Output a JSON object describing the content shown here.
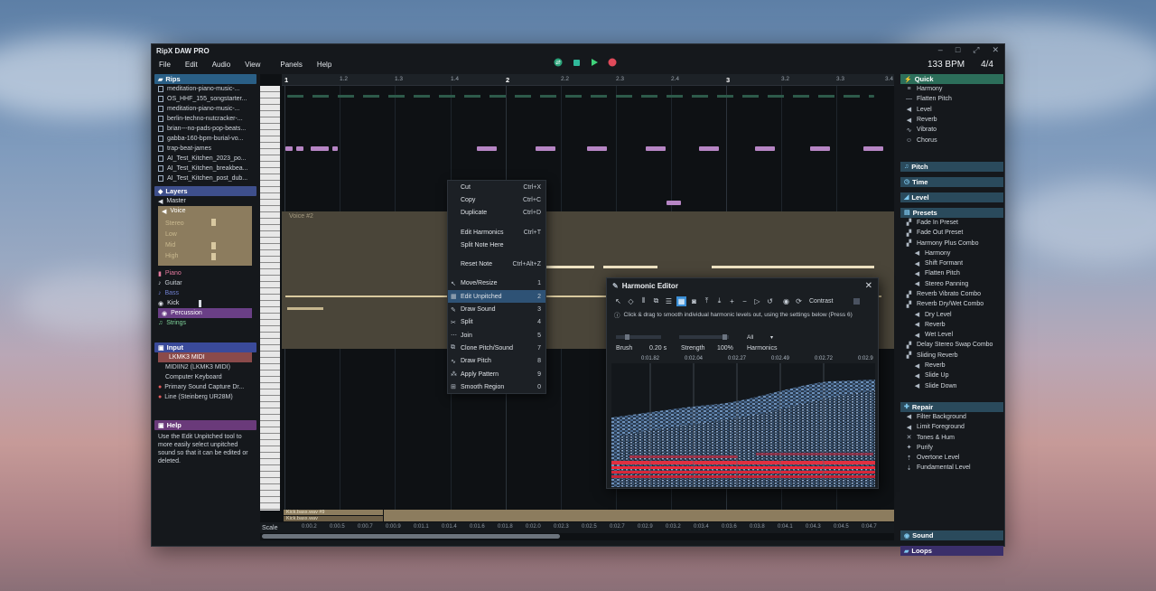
{
  "app": {
    "title": "RipX DAW PRO",
    "menu": [
      "File",
      "Edit",
      "Audio",
      "View",
      "Panels",
      "Help"
    ],
    "bpm": "133 BPM",
    "time_signature": "4/4"
  },
  "left": {
    "rips_header": "Rips",
    "rips": [
      "meditation-piano-music-...",
      "OS_HHF_155_songstarter...",
      "meditation-piano-music-...",
      "berlin-techno-nutcracker-...",
      "brian---no-pads-pop-beats...",
      "gabba-160-bpm-burial-vo...",
      "trap-beat-james",
      "AI_Test_Kitchen_2023_po...",
      "AI_Test_Kitchen_breakbea...",
      "AI_Test_Kitchen_post_dub..."
    ],
    "layers_header": "Layers",
    "layers": {
      "master": "Master",
      "voice": "Voice",
      "voice_sub": [
        "Stereo",
        "Low",
        "Mid",
        "High"
      ],
      "piano": "Piano",
      "guitar": "Guitar",
      "bass": "Bass",
      "kick": "Kick",
      "percussion": "Percussion",
      "strings": "Strings"
    },
    "input_header": "Input",
    "inputs": [
      "LKMK3 MIDI",
      "MIDIIN2 (LKMK3 MIDI)",
      "Computer Keyboard",
      "Primary Sound Capture Dr...",
      "Line (Steinberg UR28M)"
    ],
    "help_header": "Help",
    "help_text": "Use the Edit Unpitched tool to more easily select unpitched sound so that it can be edited or deleted."
  },
  "ruler": {
    "ticks": [
      "1",
      "1.2",
      "1.3",
      "1.4",
      "2",
      "2.2",
      "2.3",
      "2.4",
      "3",
      "3.2",
      "3.3",
      "3.4"
    ]
  },
  "main": {
    "voice_lane_label": "Voice #2",
    "bottom_label_1": "Kick.bass.wav #9",
    "bottom_label_2": "Kick.bass.wav",
    "scale_label": "Scale",
    "timeline": [
      "0:00.2",
      "0:00.5",
      "0:00.7",
      "0:00.9",
      "0:01.1",
      "0:01.4",
      "0:01.6",
      "0:01.8",
      "0:02.0",
      "0:02.3",
      "0:02.5",
      "0:02.7",
      "0:02.9",
      "0:03.2",
      "0:03.4",
      "0:03.6",
      "0:03.8",
      "0:04.1",
      "0:04.3",
      "0:04.5",
      "0:04.7"
    ]
  },
  "context_menu": {
    "items": [
      {
        "label": "Cut",
        "key": "Ctrl+X",
        "icon": ""
      },
      {
        "label": "Copy",
        "key": "Ctrl+C",
        "icon": ""
      },
      {
        "label": "Duplicate",
        "key": "Ctrl+D",
        "icon": ""
      },
      {
        "label": "Edit Harmonics",
        "key": "Ctrl+T",
        "icon": ""
      },
      {
        "label": "Split Note Here",
        "key": "",
        "icon": ""
      },
      {
        "label": "Reset Note",
        "key": "Ctrl+Alt+Z",
        "icon": ""
      },
      {
        "label": "Move/Resize",
        "key": "1",
        "icon": "pointer-icon"
      },
      {
        "label": "Edit Unpitched",
        "key": "2",
        "icon": "unpitched-icon"
      },
      {
        "label": "Draw Sound",
        "key": "3",
        "icon": "pencil-icon"
      },
      {
        "label": "Split",
        "key": "4",
        "icon": "split-icon"
      },
      {
        "label": "Join",
        "key": "5",
        "icon": "join-icon"
      },
      {
        "label": "Clone Pitch/Sound",
        "key": "7",
        "icon": "clone-icon"
      },
      {
        "label": "Draw Pitch",
        "key": "8",
        "icon": "draw-pitch-icon"
      },
      {
        "label": "Apply Pattern",
        "key": "9",
        "icon": "pattern-icon"
      },
      {
        "label": "Smooth Region",
        "key": "0",
        "icon": "smooth-icon"
      }
    ]
  },
  "harmonic_editor": {
    "title": "Harmonic Editor",
    "contrast_label": "Contrast",
    "info": "Click & drag to smooth individual harmonic levels out, using the settings below (Press 6)",
    "brush_label": "Brush",
    "brush_value": "0.20 s",
    "strength_label": "Strength",
    "strength_value": "100%",
    "harmonics_value": "All",
    "harmonics_label": "Harmonics",
    "times": [
      "0:01.82",
      "0:02.04",
      "0:02.27",
      "0:02.49",
      "0:02.72",
      "0:02.9"
    ]
  },
  "right": {
    "quick_header": "Quick",
    "quick": [
      "Harmony",
      "Flatten Pitch",
      "Level",
      "Reverb",
      "Vibrato",
      "Chorus"
    ],
    "pitch_header": "Pitch",
    "time_header": "Time",
    "level_header": "Level",
    "presets_header": "Presets",
    "presets": [
      {
        "label": "Fade In Preset",
        "lvl": 1
      },
      {
        "label": "Fade Out Preset",
        "lvl": 1
      },
      {
        "label": "Harmony Plus Combo",
        "lvl": 1
      },
      {
        "label": "Harmony",
        "lvl": 2
      },
      {
        "label": "Shift Formant",
        "lvl": 2
      },
      {
        "label": "Flatten Pitch",
        "lvl": 2
      },
      {
        "label": "Stereo Panning",
        "lvl": 2
      },
      {
        "label": "Reverb Vibrato Combo",
        "lvl": 1
      },
      {
        "label": "Reverb Dry/Wet Combo",
        "lvl": 1
      },
      {
        "label": "Dry Level",
        "lvl": 2
      },
      {
        "label": "Reverb",
        "lvl": 2
      },
      {
        "label": "Wet Level",
        "lvl": 2
      },
      {
        "label": "Delay Stereo Swap Combo",
        "lvl": 1
      },
      {
        "label": "Sliding Reverb",
        "lvl": 1
      },
      {
        "label": "Reverb",
        "lvl": 2
      },
      {
        "label": "Slide Up",
        "lvl": 2
      },
      {
        "label": "Slide Down",
        "lvl": 2
      }
    ],
    "repair_header": "Repair",
    "repair": [
      "Filter Background",
      "Limit Foreground",
      "Tones & Hum",
      "Purify",
      "Overtone Level",
      "Fundamental Level"
    ],
    "sound_header": "Sound",
    "loops_header": "Loops"
  },
  "colors": {
    "accent_blue": "#2e6ea8",
    "panel_header_blue": "#2a5f86",
    "quick_green": "#2c6e5a",
    "layers_blue": "#3e4f8c",
    "percussion_purple": "#6a3f86",
    "input_header": "#3a4a9a",
    "help_header": "#6a3a7a",
    "note_purple": "#b685c4",
    "voice_lane": "#4a4539"
  }
}
